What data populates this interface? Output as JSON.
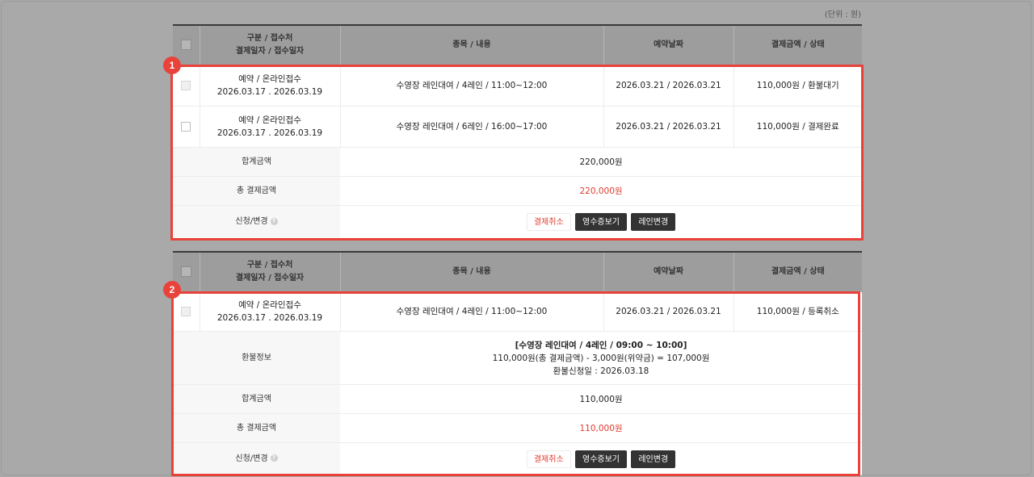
{
  "unit_label": "(단위 : 원)",
  "header": {
    "col_type": "구분 / 접수처",
    "col_type_sub": "결제일자 / 접수일자",
    "col_item": "종목 / 내용",
    "col_date": "예약날짜",
    "col_amount": "결제금액 / 상태"
  },
  "section1": {
    "badge": "1",
    "rows": [
      {
        "type": "예약 / 온라인접수",
        "dates": "2026.03.17 . 2026.03.19",
        "item": "수영장 레인대여 / 4레인 / 11:00~12:00",
        "resv": "2026.03.21 /  2026.03.21",
        "amount": "110,000원 / 환불대기"
      },
      {
        "type": "예약 / 온라인접수",
        "dates": "2026.03.17 . 2026.03.19",
        "item": "수영장 레인대여 / 6레인 / 16:00~17:00",
        "resv": "2026.03.21 /  2026.03.21",
        "amount": "110,000원 / 결제완료"
      }
    ],
    "sum_label": "합계금액",
    "sum_value": "220,000원",
    "total_label": "총 결제금액",
    "total_value": "220,000원",
    "action_label": "신청/변경",
    "help": "?",
    "btn_cancel": "결제취소",
    "btn_receipt": "영수증보기",
    "btn_lane": "레인변경"
  },
  "section2": {
    "badge": "2",
    "rows": [
      {
        "type": "예약 / 온라인접수",
        "dates": "2026.03.17 . 2026.03.19",
        "item": "수영장 레인대여 / 4레인 / 11:00~12:00",
        "resv": "2026.03.21 /  2026.03.21",
        "amount": "110,000원 / 등록취소"
      }
    ],
    "refund_label": "환불정보",
    "refund_title": "[수영장 레인대여 / 4레인 / 09:00 ~ 10:00]",
    "refund_calc": "110,000원(총 결제금액) - 3,000원(위약금) = 107,000원",
    "refund_date": "환불신청일 : 2026.03.18",
    "sum_label": "합계금액",
    "sum_value": "110,000원",
    "total_label": "총 결제금액",
    "total_value": "110,000원",
    "action_label": "신청/변경",
    "help": "?",
    "btn_cancel": "결제취소",
    "btn_receipt": "영수증보기",
    "btn_lane": "레인변경"
  },
  "colors": {
    "highlight": "#e8423a",
    "total_red": "#e03b2e",
    "dark_button": "#333333"
  }
}
